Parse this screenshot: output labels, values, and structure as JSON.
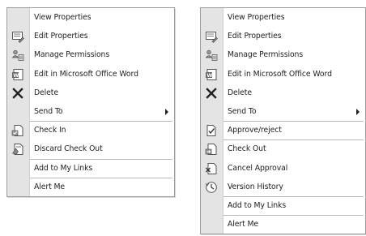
{
  "left_menu": {
    "items": [
      {
        "label": "View Properties",
        "icon": "none"
      },
      {
        "label": "Edit Properties",
        "icon": "edit-properties-icon"
      },
      {
        "label": "Manage Permissions",
        "icon": "permissions-icon"
      },
      {
        "label": "Edit in Microsoft Office Word",
        "icon": "word-icon"
      },
      {
        "label": "Delete",
        "icon": "delete-x-icon"
      },
      {
        "label": "Send To",
        "icon": "none",
        "submenu": true
      },
      {
        "label": "Check In",
        "icon": "check-in-icon"
      },
      {
        "label": "Discard Check Out",
        "icon": "discard-check-out-icon"
      },
      {
        "label": "Add to My Links",
        "icon": "none"
      },
      {
        "label": "Alert Me",
        "icon": "none"
      }
    ]
  },
  "right_menu": {
    "items": [
      {
        "label": "View Properties",
        "icon": "none"
      },
      {
        "label": "Edit Properties",
        "icon": "edit-properties-icon"
      },
      {
        "label": "Manage Permissions",
        "icon": "permissions-icon"
      },
      {
        "label": "Edit in Microsoft Office Word",
        "icon": "word-icon"
      },
      {
        "label": "Delete",
        "icon": "delete-x-icon"
      },
      {
        "label": "Send To",
        "icon": "none",
        "submenu": true
      },
      {
        "label": "Approve/reject",
        "icon": "approve-reject-icon"
      },
      {
        "label": "Check Out",
        "icon": "check-out-icon"
      },
      {
        "label": "Cancel Approval",
        "icon": "cancel-approval-icon"
      },
      {
        "label": "Version History",
        "icon": "version-history-icon"
      },
      {
        "label": "Add to My Links",
        "icon": "none"
      },
      {
        "label": "Alert Me",
        "icon": "none"
      }
    ]
  },
  "colors": {
    "gutter": "#e4e4e4",
    "border": "#9c9c9c",
    "text": "#222222",
    "icon": "#555555"
  }
}
